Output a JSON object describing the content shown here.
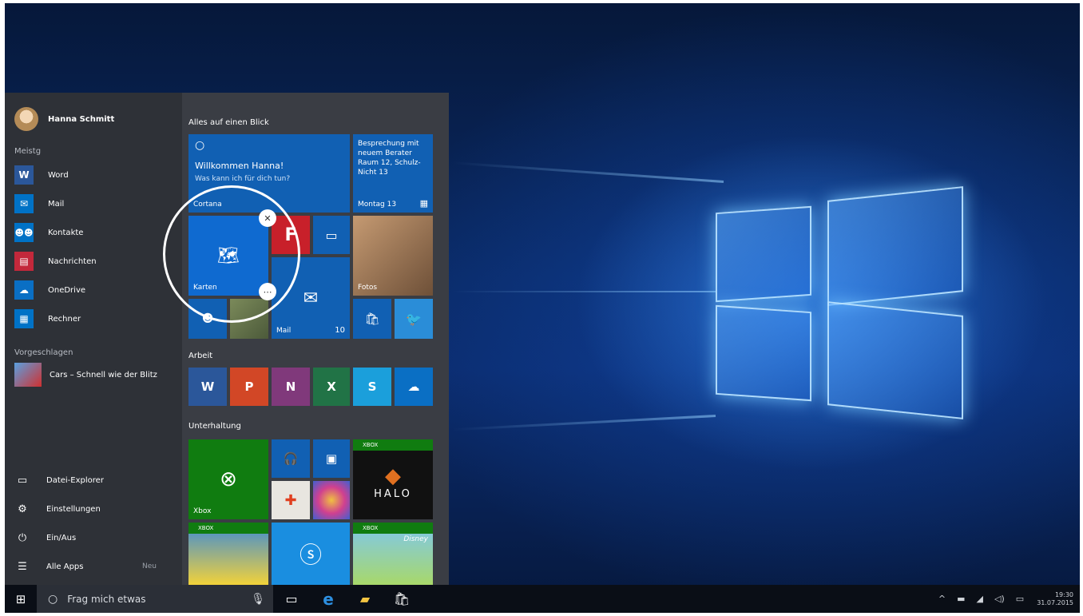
{
  "user": {
    "name": "Hanna Schmitt"
  },
  "left_menu": {
    "most_used_label": "Meistg",
    "apps": [
      {
        "label": "Word",
        "icon": "word-icon",
        "color": "#2b579a",
        "glyph": "W"
      },
      {
        "label": "Mail",
        "icon": "mail-icon",
        "color": "#0072c6",
        "glyph": "✉"
      },
      {
        "label": "Kontakte",
        "icon": "people-icon",
        "color": "#0072c6",
        "glyph": "👥"
      },
      {
        "label": "Nachrichten",
        "icon": "news-icon",
        "color": "#c3283b",
        "glyph": "▤"
      },
      {
        "label": "OneDrive",
        "icon": "onedrive-icon",
        "color": "#0a6fc4",
        "glyph": "☁"
      },
      {
        "label": "Rechner",
        "icon": "calculator-icon",
        "color": "#0072c6",
        "glyph": "▦"
      }
    ],
    "suggested_label": "Vorgeschlagen",
    "suggested_app": "Cars – Schnell wie der Blitz",
    "bottom": [
      {
        "label": "Datei-Explorer",
        "icon": "file-explorer-icon",
        "glyph": "▭"
      },
      {
        "label": "Einstellungen",
        "icon": "settings-icon",
        "glyph": "⚙"
      },
      {
        "label": "Ein/Aus",
        "icon": "power-icon",
        "glyph": "⏻"
      },
      {
        "label": "Alle Apps",
        "icon": "all-apps-icon",
        "glyph": "☰"
      }
    ],
    "new_label": "Neu"
  },
  "tiles": {
    "group1_label": "Alles auf einen Blick",
    "cortana": {
      "title": "Willkommen Hanna!",
      "subtitle": "Was kann ich für dich tun?",
      "caption": "Cortana"
    },
    "calendar": {
      "text": "Besprechung mit neuem Berater Raum 12, Schulz-Nicht 13",
      "caption": "Montag 13"
    },
    "maps": {
      "caption": "Karten"
    },
    "mail": {
      "caption": "Mail",
      "count": "10"
    },
    "photos": {
      "caption": "Fotos"
    },
    "group2_label": "Arbeit",
    "group3_label": "Unterhaltung",
    "xbox": {
      "caption": "Xbox"
    },
    "xbox_badge": "XBOX",
    "halo": "HALO",
    "disney": "Disney"
  },
  "taskbar": {
    "search_placeholder": "Frag mich etwas",
    "time": "19:30",
    "date": "31.07.2015"
  },
  "colors": {
    "accent": "#0a5fb5",
    "start_bg": "#3a3d44",
    "taskbar_bg": "#0a0e16"
  }
}
